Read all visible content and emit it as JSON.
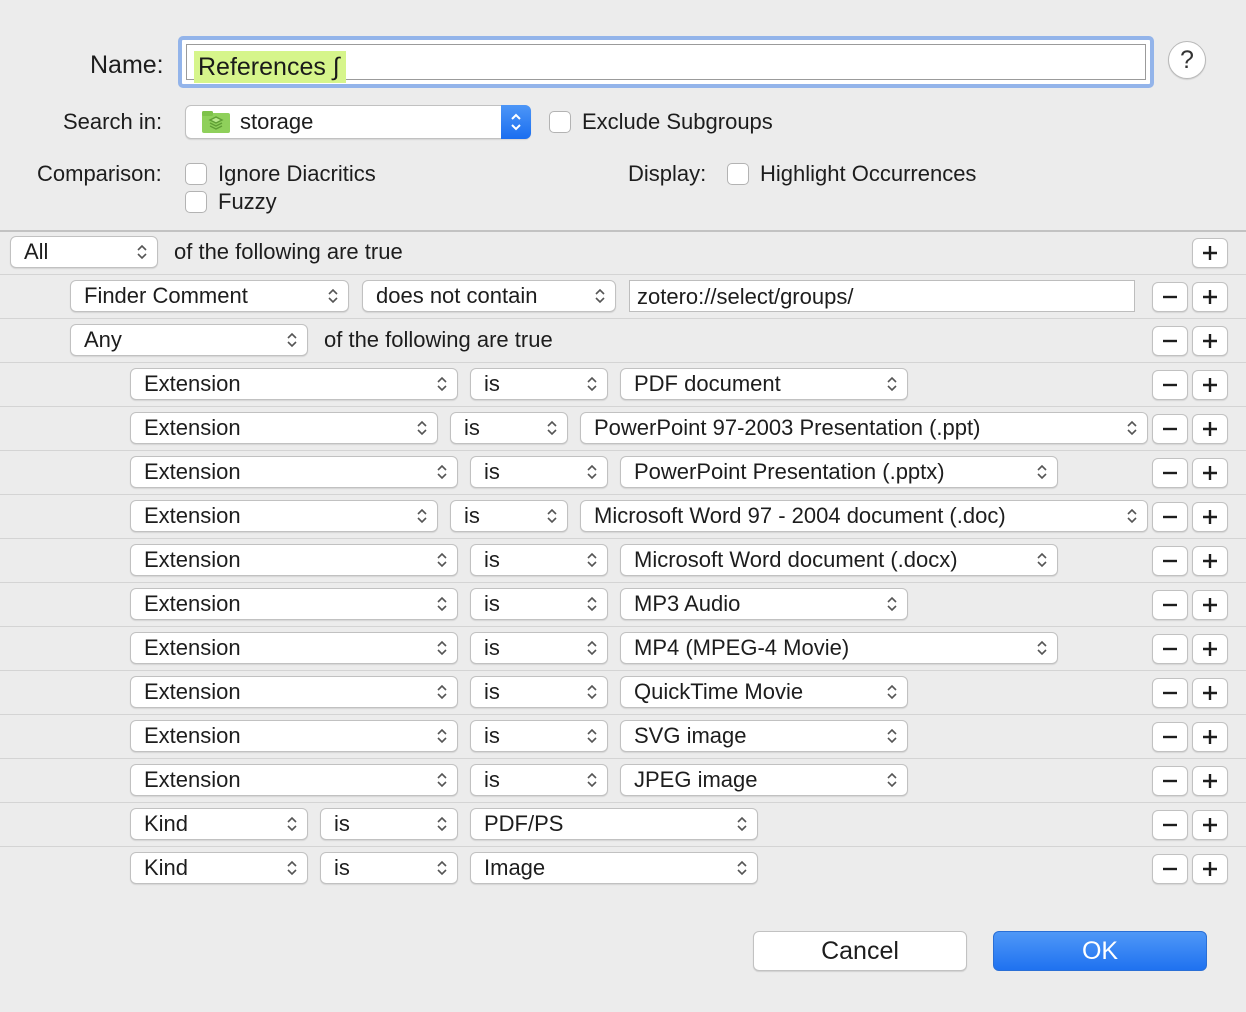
{
  "name": {
    "label": "Name:",
    "value": "References ∫"
  },
  "help_label": "?",
  "search_in": {
    "label": "Search in:",
    "value": "storage",
    "folder_icon": "group-folder-icon"
  },
  "exclude_subgroups": {
    "label": "Exclude Subgroups",
    "checked": false
  },
  "comparison": {
    "label": "Comparison:",
    "ignore_diacritics": "Ignore Diacritics",
    "fuzzy": "Fuzzy"
  },
  "display": {
    "label": "Display:",
    "highlight": "Highlight Occurrences"
  },
  "root": {
    "quantifier": "All",
    "suffix": "of the following are true"
  },
  "rule1": {
    "field": "Finder Comment",
    "op": "does not contain",
    "value": "zotero://select/groups/"
  },
  "group": {
    "quantifier": "Any",
    "suffix": "of the following are true"
  },
  "conditions": [
    {
      "field": "Extension",
      "op": "is",
      "value": "PDF document"
    },
    {
      "field": "Extension",
      "op": "is",
      "value": "PowerPoint 97-2003 Presentation (.ppt)"
    },
    {
      "field": "Extension",
      "op": "is",
      "value": "PowerPoint Presentation (.pptx)"
    },
    {
      "field": "Extension",
      "op": "is",
      "value": "Microsoft Word 97 - 2004 document (.doc)"
    },
    {
      "field": "Extension",
      "op": "is",
      "value": "Microsoft Word document (.docx)"
    },
    {
      "field": "Extension",
      "op": "is",
      "value": "MP3 Audio"
    },
    {
      "field": "Extension",
      "op": "is",
      "value": "MP4 (MPEG-4 Movie)"
    },
    {
      "field": "Extension",
      "op": "is",
      "value": "QuickTime Movie"
    },
    {
      "field": "Extension",
      "op": "is",
      "value": "SVG image"
    },
    {
      "field": "Extension",
      "op": "is",
      "value": "JPEG image"
    },
    {
      "field": "Kind",
      "op": "is",
      "value": "PDF/PS"
    },
    {
      "field": "Kind",
      "op": "is",
      "value": "Image"
    }
  ],
  "buttons": {
    "cancel": "Cancel",
    "ok": "OK"
  },
  "colors": {
    "accent": "#1f72f0",
    "name_highlight": "#d6f58b",
    "focus_ring": "#93b4ea"
  }
}
